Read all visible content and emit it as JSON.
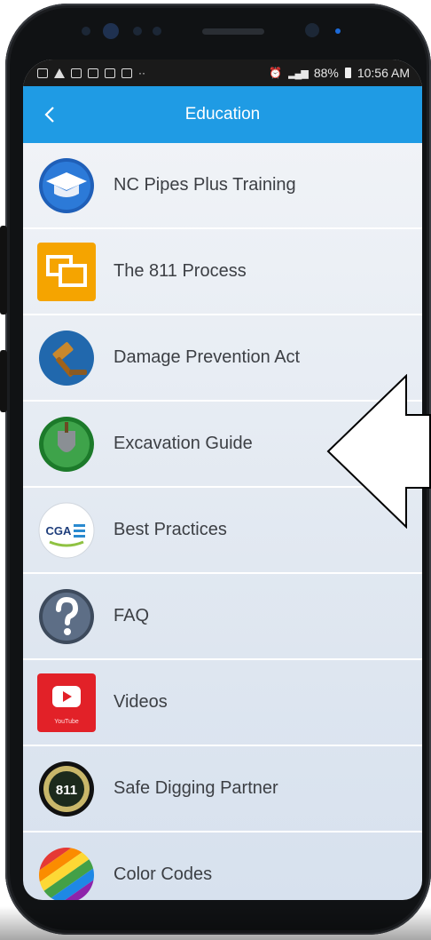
{
  "status_bar": {
    "battery": "88%",
    "time": "10:56 AM"
  },
  "app_bar": {
    "title": "Education",
    "back_icon": "chevron-left-icon"
  },
  "items": [
    {
      "label": "NC Pipes Plus Training",
      "icon": "graduation-cap-icon"
    },
    {
      "label": "The 811 Process",
      "icon": "monitors-icon"
    },
    {
      "label": "Damage Prevention Act",
      "icon": "gavel-icon"
    },
    {
      "label": "Excavation Guide",
      "icon": "shovel-icon"
    },
    {
      "label": "Best Practices",
      "icon": "cga-logo-icon"
    },
    {
      "label": "FAQ",
      "icon": "question-icon"
    },
    {
      "label": "Videos",
      "icon": "youtube-icon"
    },
    {
      "label": "Safe Digging Partner",
      "icon": "811-badge-icon"
    },
    {
      "label": "Color Codes",
      "icon": "color-wheel-icon"
    }
  ],
  "icon_text": {
    "cga": "CGA",
    "youtube": "YouTube",
    "badge": "811"
  },
  "colors": {
    "app_bar": "#1f9be4",
    "callout_arrow": "#000000"
  }
}
